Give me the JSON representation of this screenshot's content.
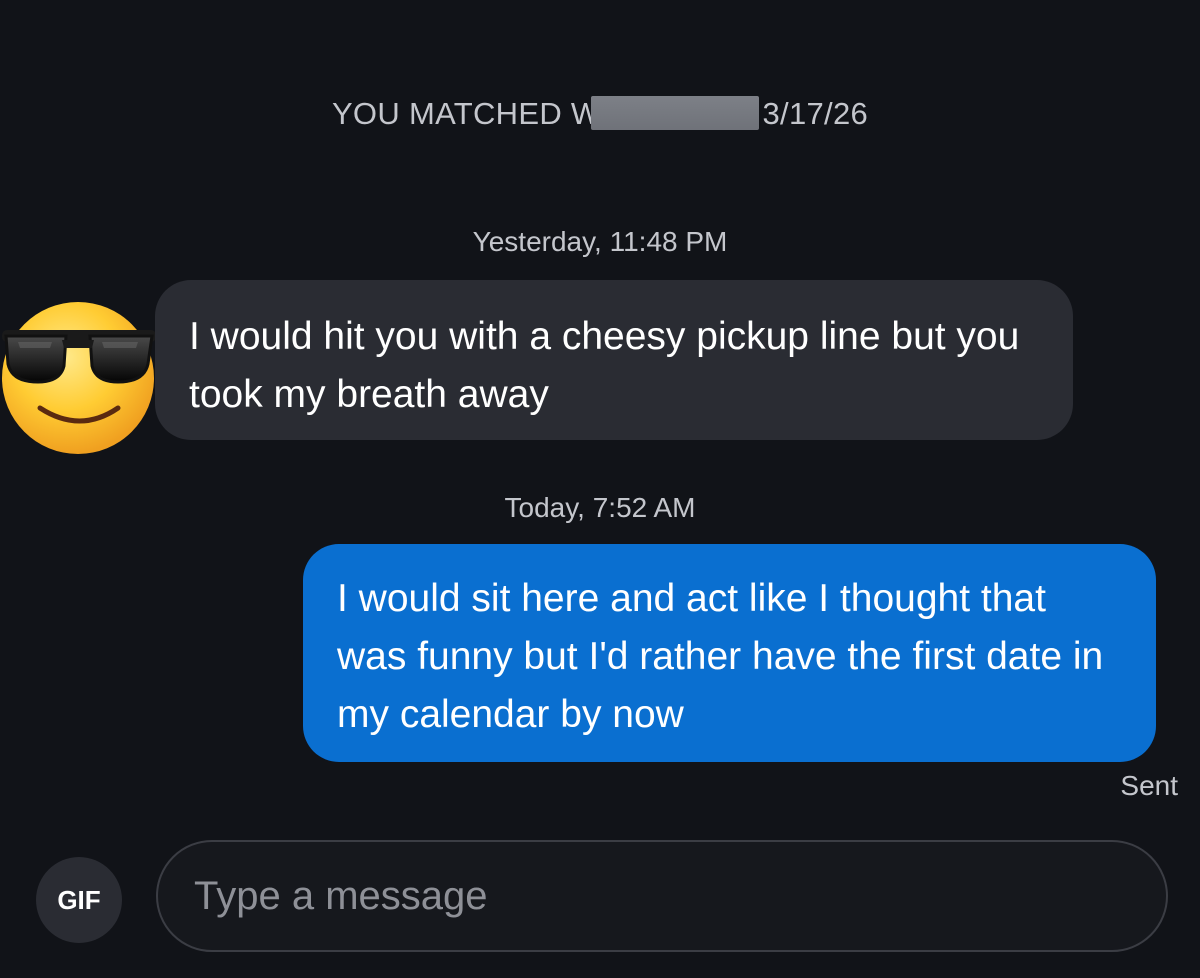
{
  "header": {
    "match_prefix": "YOU MATCHED W",
    "match_date": "3/17/26"
  },
  "messages": [
    {
      "timestamp": "Yesterday, 11:48 PM",
      "sender": "them",
      "avatar_icon": "smiling-face-with-sunglasses-emoji",
      "text": "I would hit you with a cheesy pickup line but you took my breath away"
    },
    {
      "timestamp": "Today, 7:52 AM",
      "sender": "me",
      "text": "I would sit here and act like I thought that was funny but I'd rather have the first date in my calendar by now",
      "status": "Sent"
    }
  ],
  "composer": {
    "gif_label": "GIF",
    "placeholder": "Type a message"
  },
  "colors": {
    "background": "#111318",
    "incoming_bubble": "#2a2c33",
    "outgoing_bubble": "#0a6fd0",
    "muted_text": "#c4c6cc"
  }
}
